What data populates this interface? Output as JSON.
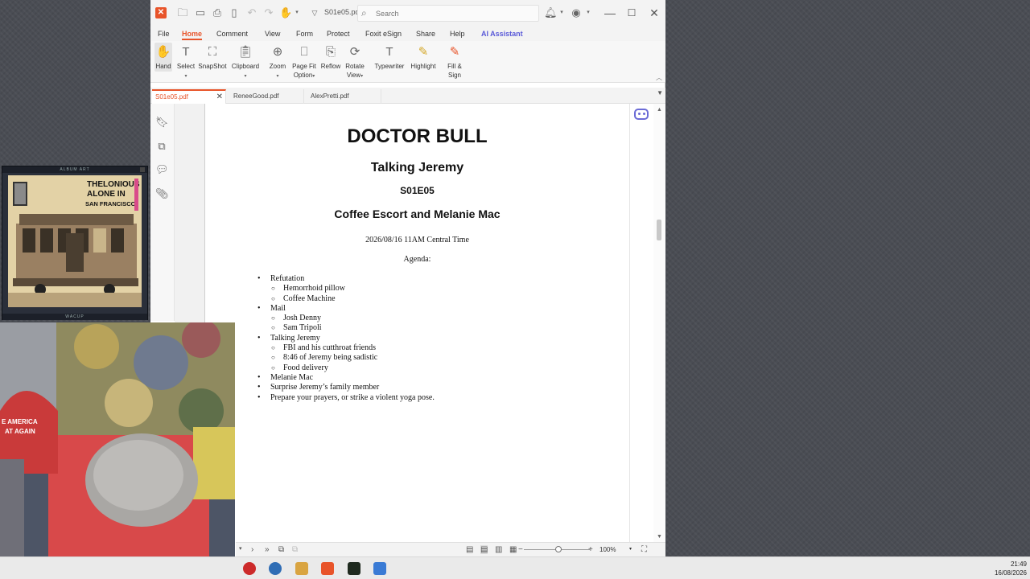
{
  "titlebar": {
    "document_title": "S01e05.pdf",
    "search_placeholder": "Search"
  },
  "menu": {
    "items": [
      "File",
      "Home",
      "Comment",
      "View",
      "Form",
      "Protect",
      "Foxit eSign",
      "Share",
      "Help",
      "AI Assistant"
    ],
    "active": "Home"
  },
  "ribbon": {
    "hand": "Hand",
    "select": "Select",
    "snapshot": "SnapShot",
    "clipboard": "Clipboard",
    "zoom": "Zoom",
    "page_fit_1": "Page Fit",
    "page_fit_2": "Option",
    "reflow": "Reflow",
    "rotate_1": "Rotate",
    "rotate_2": "View",
    "typewriter": "Typewriter",
    "highlight": "Highlight",
    "fill_sign_1": "Fill &",
    "fill_sign_2": "Sign"
  },
  "tabs": [
    "S01e05.pdf",
    "ReneeGood.pdf",
    "AlexPretti.pdf"
  ],
  "pdf": {
    "title": "DOCTOR BULL",
    "subtitle": "Talking Jeremy",
    "episode": "S01E05",
    "guests": "Coffee Escort and Melanie Mac",
    "datetime": "2026/08/16 11AM Central Time",
    "agenda_label": "Agenda:",
    "agenda": [
      {
        "text": "Refutation",
        "level": 1
      },
      {
        "text": "Hemorrhoid pillow",
        "level": 2
      },
      {
        "text": "Coffee Machine",
        "level": 2
      },
      {
        "text": "Mail",
        "level": 1
      },
      {
        "text": "Josh Denny",
        "level": 2
      },
      {
        "text": "Sam Tripoli",
        "level": 2
      },
      {
        "text": "Talking Jeremy",
        "level": 1
      },
      {
        "text": "FBI and his cutthroat friends",
        "level": 2
      },
      {
        "text": "8:46 of Jeremy being sadistic",
        "level": 2
      },
      {
        "text": "Food delivery",
        "level": 2
      },
      {
        "text": "Melanie Mac",
        "level": 1
      },
      {
        "text": "Surprise Jeremy’s family member",
        "level": 1
      },
      {
        "text": "Prepare your prayers, or strike a violent yoga pose.",
        "level": 1
      }
    ]
  },
  "statusbar": {
    "zoom_value": "100%",
    "zoom_level_fraction": 0.5
  },
  "wacup": {
    "header": "ALBUM ART",
    "footer": "WACUP",
    "album_text_1": "THELONIOUS",
    "album_text_2": "ALONE IN",
    "album_text_3": "SAN FRANCISCO"
  },
  "webcam": {
    "cap_text_1": "E AMERICA",
    "cap_text_2": "AT AGAIN"
  },
  "taskbar": {
    "time": "21:49",
    "date": "16/08/2026"
  },
  "colors": {
    "accent": "#e8542a",
    "ai_accent": "#5a5ad8",
    "desktop": "#4a4d54"
  }
}
